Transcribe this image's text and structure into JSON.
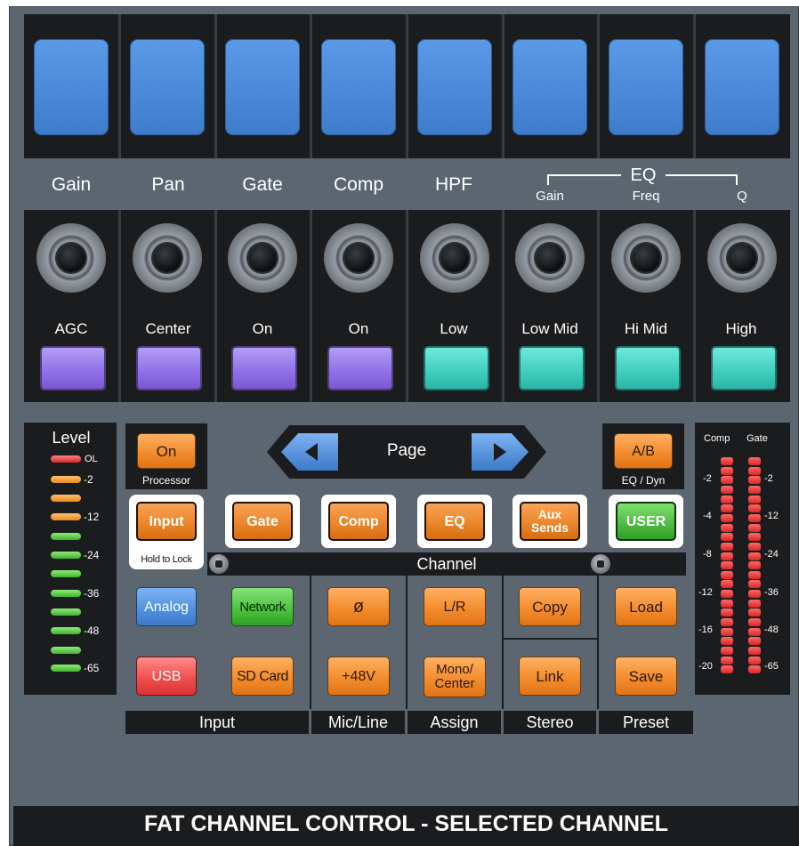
{
  "top_labels": [
    "Gain",
    "Pan",
    "Gate",
    "Comp",
    "HPF"
  ],
  "eq": {
    "title": "EQ",
    "gain": "Gain",
    "freq": "Freq",
    "q": "Q"
  },
  "pad_labels": [
    "AGC",
    "Center",
    "On",
    "On",
    "Low",
    "Low Mid",
    "Hi Mid",
    "High"
  ],
  "pad_colors": {
    "purple": "#8f6fe6",
    "teal": "#3fcdbd"
  },
  "meter": {
    "title": "Level",
    "marks": [
      "OL",
      "-2",
      "-12",
      "-24",
      "-36",
      "-48",
      "-65"
    ]
  },
  "processor": {
    "on_label": "On",
    "caption": "Processor"
  },
  "page": {
    "label": "Page",
    "prev_icon": "left-arrow-icon",
    "next_icon": "right-arrow-icon"
  },
  "ab": {
    "label": "A/B",
    "caption": "EQ / Dyn"
  },
  "channel_buttons": {
    "input": "Input",
    "gate": "Gate",
    "comp": "Comp",
    "eq": "EQ",
    "aux": "Aux Sends",
    "user": "USER"
  },
  "hold_to_lock": "Hold to Lock",
  "channel_label": "Channel",
  "input_buttons": {
    "analog": "Analog",
    "network": "Network",
    "usb": "USB",
    "sdcard": "SD Card"
  },
  "mic_buttons": {
    "phase": "ø",
    "phantom": "+48V"
  },
  "assign_buttons": {
    "lr": "L/R",
    "mono": "Mono/ Center"
  },
  "stereo_buttons": {
    "copy": "Copy",
    "link": "Link"
  },
  "preset_buttons": {
    "load": "Load",
    "save": "Save"
  },
  "sections": {
    "input": "Input",
    "mic": "Mic/Line",
    "assign": "Assign",
    "stereo": "Stereo",
    "preset": "Preset"
  },
  "right_meter": {
    "comp": "Comp",
    "gate": "Gate",
    "comp_marks": [
      "-2",
      "-4",
      "-8",
      "-12",
      "-16",
      "-20"
    ],
    "gate_marks": [
      "-2",
      "-12",
      "-24",
      "-36",
      "-48",
      "-65"
    ]
  },
  "footer": "FAT CHANNEL CONTROL - SELECTED CHANNEL"
}
